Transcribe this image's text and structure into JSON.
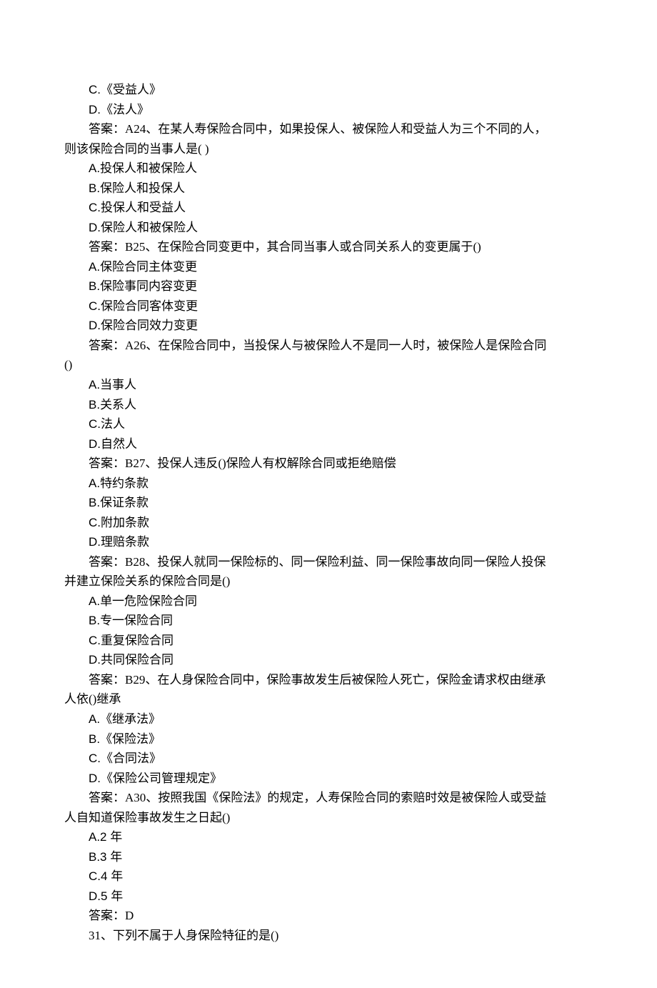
{
  "lines": [
    {
      "cls": "indent2 mixed",
      "pre": "C.",
      "cj": "《受益人》"
    },
    {
      "cls": "indent2 mixed",
      "pre": "D.",
      "cj": "《法人》"
    },
    {
      "cls": "indent2",
      "text": "答案：A24、在某人寿保险合同中，如果投保人、被保险人和受益人为三个不同的人，"
    },
    {
      "cls": "",
      "text": "则该保险合同的当事人是( )"
    },
    {
      "cls": "indent2 mixed",
      "pre": "A.",
      "cj": "投保人和被保险人"
    },
    {
      "cls": "indent2 mixed",
      "pre": "B.",
      "cj": "保险人和投保人"
    },
    {
      "cls": "indent2 mixed",
      "pre": "C.",
      "cj": "投保人和受益人"
    },
    {
      "cls": "indent2 mixed",
      "pre": "D.",
      "cj": "保险人和被保险人"
    },
    {
      "cls": "indent2",
      "text": "答案：B25、在保险合同变更中，其合同当事人或合同关系人的变更属于()"
    },
    {
      "cls": "indent2 mixed",
      "pre": "A.",
      "cj": "保险合同主体变更"
    },
    {
      "cls": "indent2 mixed",
      "pre": "B.",
      "cj": "保险事同内容变更"
    },
    {
      "cls": "indent2 mixed",
      "pre": "C.",
      "cj": "保险合同客体变更"
    },
    {
      "cls": "indent2 mixed",
      "pre": "D.",
      "cj": "保险合同效力变更"
    },
    {
      "cls": "indent2",
      "text": "答案：A26、在保险合同中，当投保人与被保险人不是同一人时，被保险人是保险合同"
    },
    {
      "cls": "",
      "text": "()"
    },
    {
      "cls": "indent2 mixed",
      "pre": "A.",
      "cj": "当事人"
    },
    {
      "cls": "indent2 mixed",
      "pre": "B.",
      "cj": "关系人"
    },
    {
      "cls": "indent2 mixed",
      "pre": "C.",
      "cj": "法人"
    },
    {
      "cls": "indent2 mixed",
      "pre": "D.",
      "cj": "自然人"
    },
    {
      "cls": "indent2",
      "text": "答案：B27、投保人违反()保险人有权解除合同或拒绝赔偿"
    },
    {
      "cls": "indent2 mixed",
      "pre": "A.",
      "cj": "特约条款"
    },
    {
      "cls": "indent2 mixed",
      "pre": "B.",
      "cj": "保证条款"
    },
    {
      "cls": "indent2 mixed",
      "pre": "C.",
      "cj": "附加条款"
    },
    {
      "cls": "indent2 mixed",
      "pre": "D.",
      "cj": "理赔条款"
    },
    {
      "cls": "indent2",
      "text": "答案：B28、投保人就同一保险标的、同一保险利益、同一保险事故向同一保险人投保"
    },
    {
      "cls": "",
      "text": "并建立保险关系的保险合同是()"
    },
    {
      "cls": "indent2 mixed",
      "pre": "A.",
      "cj": "单一危险保险合同"
    },
    {
      "cls": "indent2 mixed",
      "pre": "B.",
      "cj": "专一保险合同"
    },
    {
      "cls": "indent2 mixed",
      "pre": "C.",
      "cj": "重复保险合同"
    },
    {
      "cls": "indent2 mixed",
      "pre": "D.",
      "cj": "共同保险合同"
    },
    {
      "cls": "indent2",
      "text": "答案：B29、在人身保险合同中，保险事故发生后被保险人死亡，保险金请求权由继承"
    },
    {
      "cls": "",
      "text": "人依()继承"
    },
    {
      "cls": "indent2 mixed",
      "pre": "A.",
      "cj": "《继承法》"
    },
    {
      "cls": "indent2 mixed",
      "pre": "B.",
      "cj": "《保险法》"
    },
    {
      "cls": "indent2 mixed",
      "pre": "C.",
      "cj": "《合同法》"
    },
    {
      "cls": "indent2 mixed",
      "pre": "D.",
      "cj": "《保险公司管理规定》"
    },
    {
      "cls": "indent2",
      "text": "答案：A30、按照我国《保险法》的规定，人寿保险合同的索赔时效是被保险人或受益"
    },
    {
      "cls": "",
      "text": "人自知道保险事故发生之日起()"
    },
    {
      "cls": "indent2 mixed",
      "pre": "A.2 ",
      "cj": "年"
    },
    {
      "cls": "indent2 mixed",
      "pre": "B.3 ",
      "cj": "年"
    },
    {
      "cls": "indent2 mixed",
      "pre": "C.4 ",
      "cj": "年"
    },
    {
      "cls": "indent2 mixed",
      "pre": "D.5 ",
      "cj": "年"
    },
    {
      "cls": "indent2",
      "text": "答案：D"
    },
    {
      "cls": "indent2",
      "text": "31、下列不属于人身保险特征的是()"
    }
  ]
}
